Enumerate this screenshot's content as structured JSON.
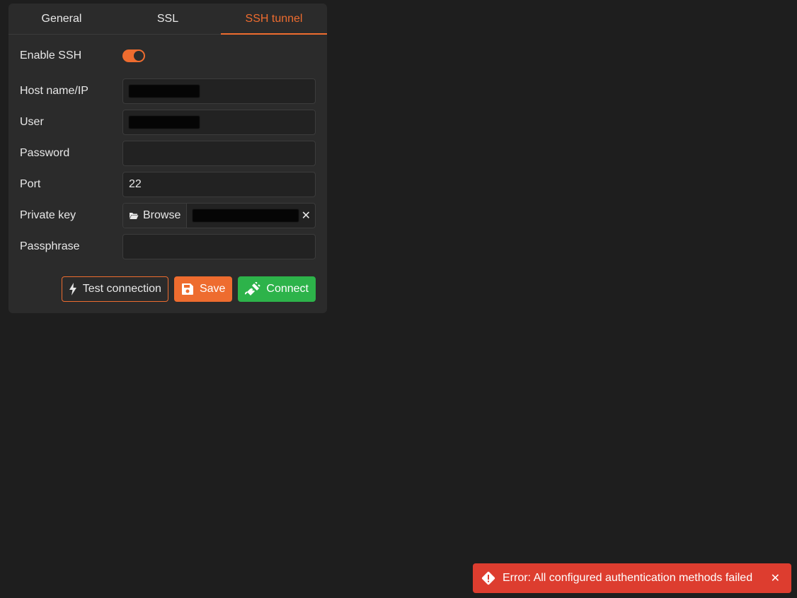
{
  "tabs": [
    {
      "label": "General",
      "active": false
    },
    {
      "label": "SSL",
      "active": false
    },
    {
      "label": "SSH tunnel",
      "active": true
    }
  ],
  "form": {
    "enable_ssh": {
      "label": "Enable SSH",
      "on": true
    },
    "host": {
      "label": "Host name/IP",
      "value": ""
    },
    "user": {
      "label": "User",
      "value": ""
    },
    "password": {
      "label": "Password",
      "value": ""
    },
    "port": {
      "label": "Port",
      "value": "22"
    },
    "private_key": {
      "label": "Private key",
      "browse_label": "Browse",
      "value": ""
    },
    "passphrase": {
      "label": "Passphrase",
      "value": ""
    }
  },
  "actions": {
    "test_label": "Test connection",
    "save_label": "Save",
    "connect_label": "Connect"
  },
  "toast": {
    "message": "Error: All configured authentication methods failed",
    "close_glyph": "✕"
  },
  "colors": {
    "accent": "#ee6c2f",
    "success": "#2db34a",
    "error": "#dd3d2f",
    "background": "#1e1e1e",
    "panel": "#2b2b2b"
  },
  "icons": {
    "browse": "folder-open-icon",
    "test": "bolt-icon",
    "save": "floppy-disk-icon",
    "connect": "plug-icon",
    "toast": "warning-diamond-icon"
  }
}
